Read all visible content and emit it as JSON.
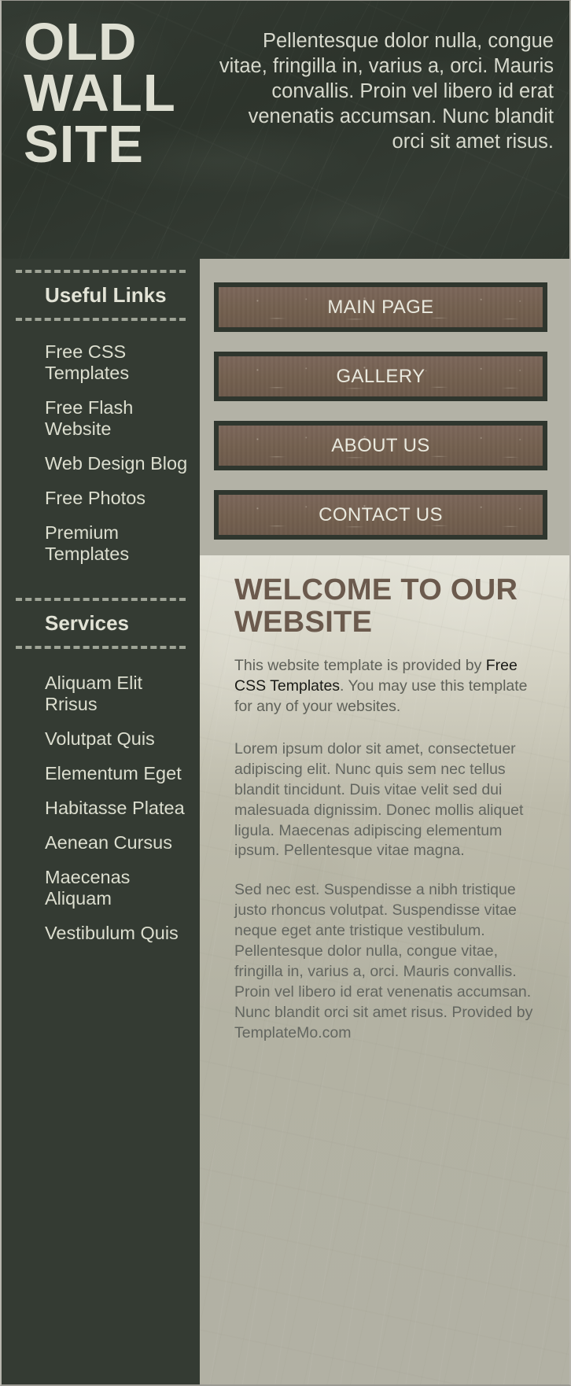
{
  "header": {
    "title": "OLD WALL SITE",
    "tagline": "Pellentesque dolor nulla, congue vitae, fringilla in, varius a, orci. Mauris convallis. Proin vel libero id erat venenatis accumsan. Nunc blandit orci sit amet risus."
  },
  "sidebar": {
    "useful_links_heading": "Useful Links",
    "useful_links": [
      {
        "label": "Free CSS Templates"
      },
      {
        "label": "Free Flash Website"
      },
      {
        "label": "Web Design Blog"
      },
      {
        "label": "Free Photos"
      },
      {
        "label": "Premium Templates"
      }
    ],
    "services_heading": "Services",
    "services": [
      {
        "label": "Aliquam Elit Rrisus"
      },
      {
        "label": "Volutpat Quis"
      },
      {
        "label": "Elementum Eget"
      },
      {
        "label": "Habitasse Platea"
      },
      {
        "label": "Aenean Cursus"
      },
      {
        "label": "Maecenas Aliquam"
      },
      {
        "label": "Vestibulum Quis"
      }
    ]
  },
  "nav": {
    "buttons": [
      {
        "label": "MAIN PAGE"
      },
      {
        "label": "GALLERY"
      },
      {
        "label": "ABOUT US"
      },
      {
        "label": "CONTACT US"
      }
    ]
  },
  "main": {
    "welcome_title": "WELCOME TO OUR WEBSITE",
    "intro_before_link": "This website template is provided by ",
    "intro_link": "Free CSS Templates",
    "intro_after_link": ". You may use this template for any of your websites.",
    "paragraph_2": "Lorem ipsum dolor sit amet, consectetuer adipiscing elit. Nunc quis sem nec tellus blandit tincidunt. Duis vitae velit sed dui malesuada dignissim. Donec mollis aliquet ligula. Maecenas adipiscing elementum ipsum. Pellentesque vitae magna.",
    "paragraph_3": "Sed nec est. Suspendisse a nibh tristique justo rhoncus volutpat. Suspendisse vitae neque eget ante tristique vestibulum. Pellentesque dolor nulla, congue vitae, fringilla in, varius a, orci. Mauris convallis. Proin vel libero id erat venenatis accumsan. Nunc blandit orci sit amet risus. Provided by TemplateMo.com"
  },
  "colors": {
    "dark_panel": "#343b33",
    "light_panel": "#b3b2a6",
    "brick_button": "#73604f",
    "heading_brown": "#6b5a4d",
    "text_cream": "#dcdecf"
  }
}
